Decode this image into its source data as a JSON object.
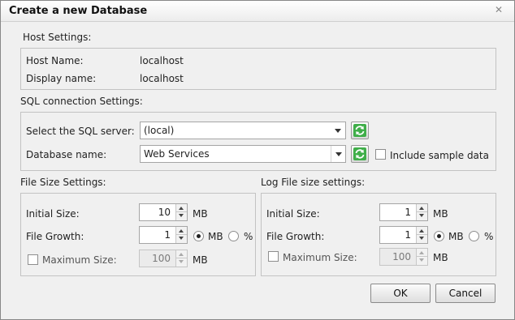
{
  "dialog": {
    "title": "Create a new Database",
    "close_icon": "close-x-icon"
  },
  "host": {
    "section_label": "Host Settings:",
    "host_name_label": "Host Name:",
    "host_name_value": "localhost",
    "display_name_label": "Display name:",
    "display_name_value": "localhost"
  },
  "sql": {
    "section_label": "SQL connection Settings:",
    "server_label": "Select the SQL server:",
    "server_value": "(local)",
    "db_name_label": "Database name:",
    "db_name_value": "Web Services",
    "include_sample_label": "Include sample data",
    "include_sample_checked": false,
    "refresh_icon": "refresh-icon"
  },
  "file_size": {
    "section_label": "File Size Settings:",
    "initial_size_label": "Initial Size:",
    "initial_size_value": "10",
    "initial_size_unit": "MB",
    "growth_label": "File Growth:",
    "growth_value": "1",
    "growth_unit_mb": "MB",
    "growth_unit_pct": "%",
    "growth_unit_selected": "MB",
    "max_size_label": "Maximum Size:",
    "max_size_value": "100",
    "max_size_unit": "MB",
    "max_size_checked": false
  },
  "log_size": {
    "section_label": "Log File size settings:",
    "initial_size_label": "Initial Size:",
    "initial_size_value": "1",
    "initial_size_unit": "MB",
    "growth_label": "File Growth:",
    "growth_value": "1",
    "growth_unit_mb": "MB",
    "growth_unit_pct": "%",
    "growth_unit_selected": "MB",
    "max_size_label": "Maximum Size:",
    "max_size_value": "100",
    "max_size_unit": "MB",
    "max_size_checked": false
  },
  "buttons": {
    "ok_label": "OK",
    "cancel_label": "Cancel"
  }
}
